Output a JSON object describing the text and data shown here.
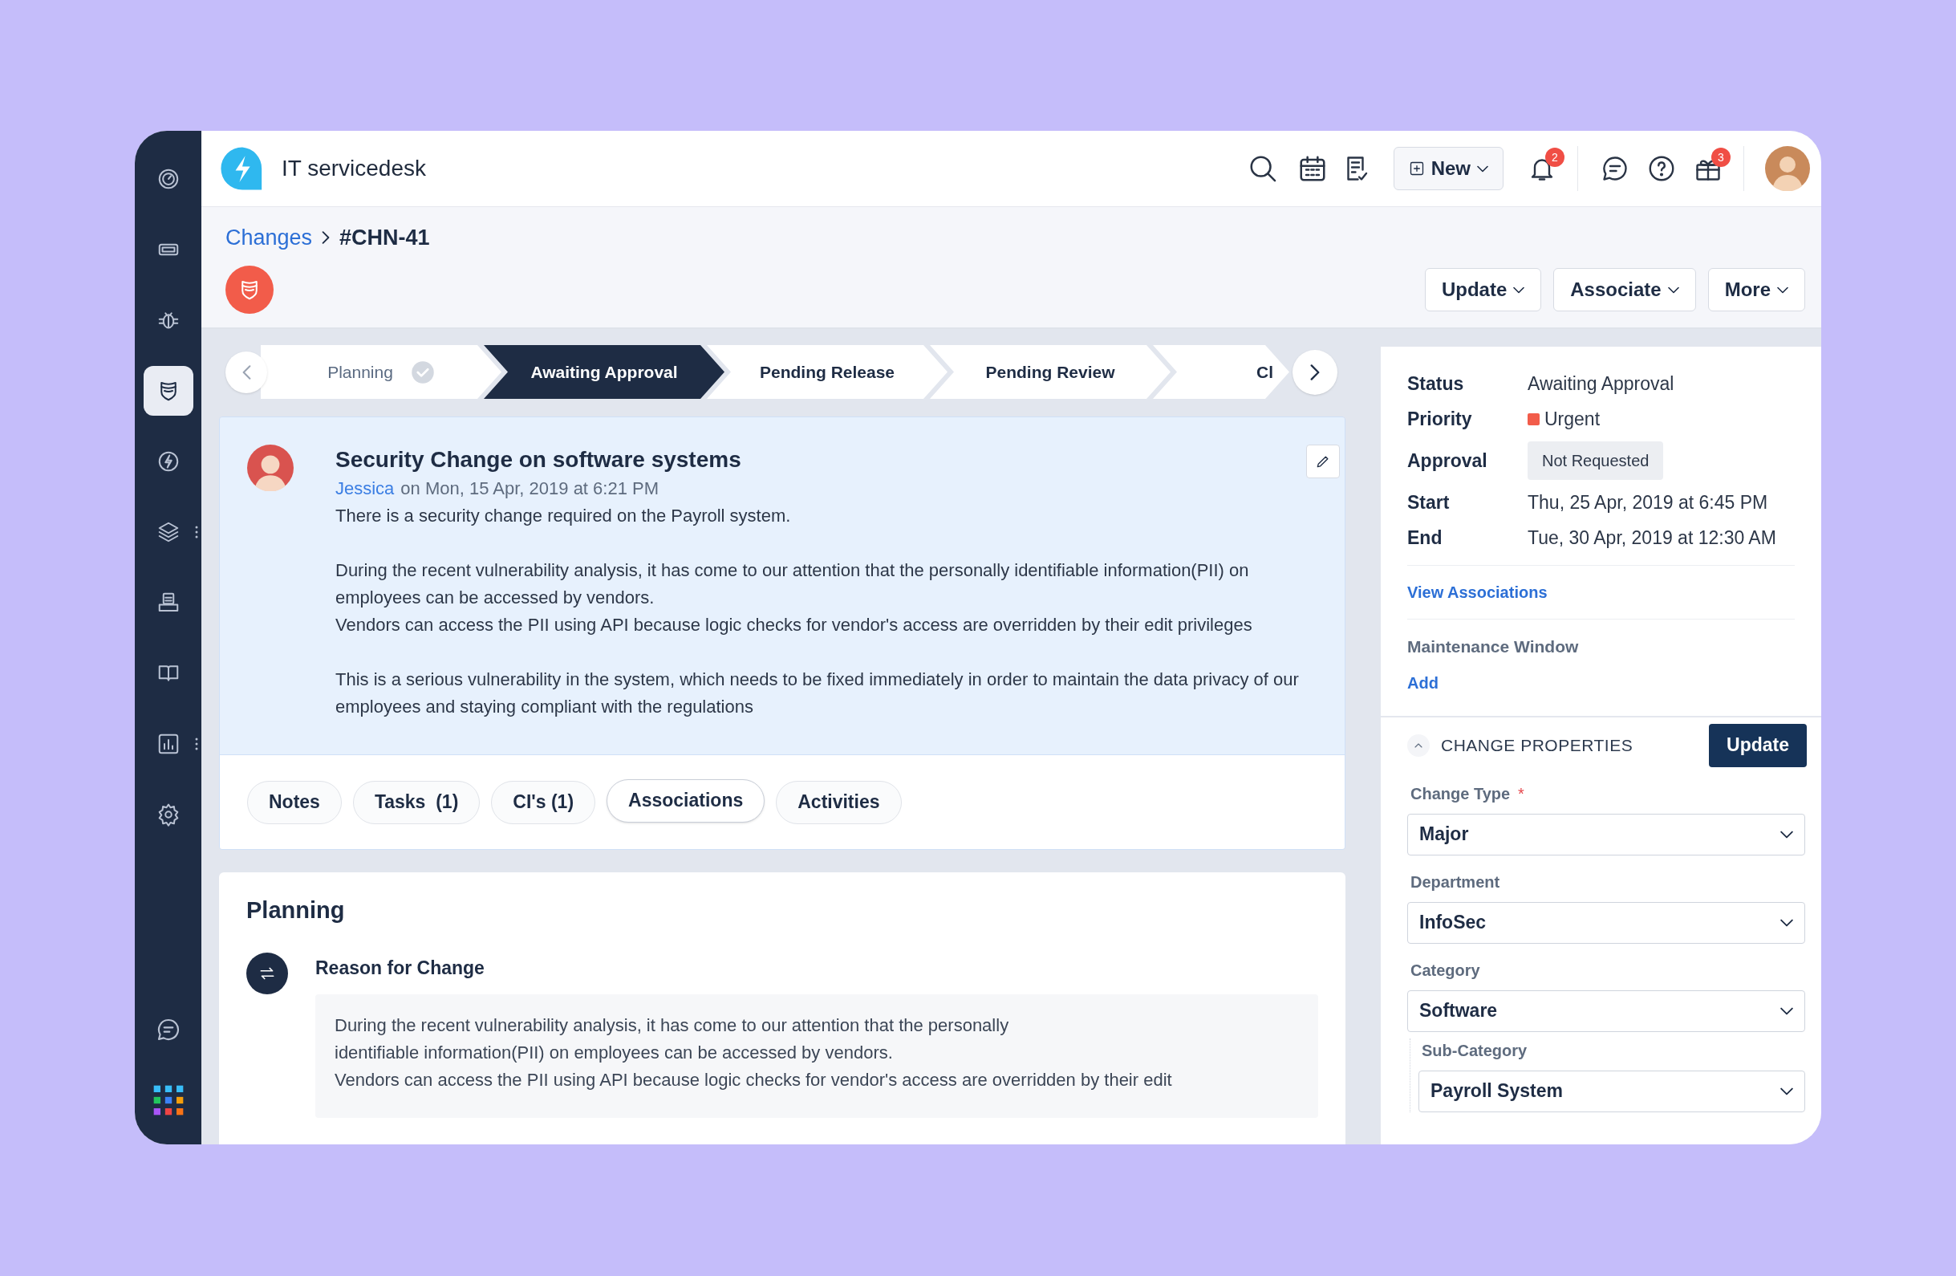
{
  "app": {
    "title": "IT servicedesk"
  },
  "sidebar": {
    "items": [
      {
        "selected": false,
        "menu": false
      },
      {
        "selected": false,
        "menu": false
      },
      {
        "selected": false,
        "menu": false
      },
      {
        "selected": true,
        "menu": false
      },
      {
        "selected": false,
        "menu": false
      },
      {
        "selected": false,
        "menu": true
      },
      {
        "selected": false,
        "menu": false
      },
      {
        "selected": false,
        "menu": false
      },
      {
        "selected": false,
        "menu": true
      },
      {
        "selected": false,
        "menu": false
      }
    ],
    "bottom_items": [
      {
        "selected": false
      },
      {
        "selected": false
      }
    ]
  },
  "top_bar": {
    "new_button": "New",
    "notification_count": "2",
    "gift_count": "3"
  },
  "breadcrumb": {
    "parent": "Changes",
    "current": "#CHN-41"
  },
  "actions": [
    "Update",
    "Associate",
    "More"
  ],
  "stepper": {
    "steps": [
      {
        "label": "Planning",
        "done": true,
        "selected": false
      },
      {
        "label": "Awaiting Approval",
        "done": false,
        "selected": true
      },
      {
        "label": "Pending Release",
        "done": false,
        "selected": false
      },
      {
        "label": "Pending Review",
        "done": false,
        "selected": false
      },
      {
        "label": "Cl",
        "done": false,
        "selected": false
      }
    ]
  },
  "request": {
    "title": "Security Change on software systems",
    "author": "Jessica",
    "meta": "on Mon, 15 Apr, 2019 at 6:21 PM",
    "paragraphs": [
      [
        "There is a security change required on the Payroll system."
      ],
      [
        "During the recent vulnerability analysis, it has come to our attention that the personally identifiable information(PII) on employees can be accessed by vendors.",
        "Vendors can access the PII using API because logic checks for vendor's access are overridden by their edit privileges"
      ],
      [
        "This is a serious vulnerability in the system, which needs to be fixed immediately in order to maintain the data privacy of our employees and staying compliant with the regulations"
      ]
    ]
  },
  "tabs": [
    {
      "label": "Notes",
      "selected": false
    },
    {
      "label": "Tasks  (1)",
      "selected": false
    },
    {
      "label": "CI's (1)",
      "selected": false
    },
    {
      "label": "Associations",
      "selected": true
    },
    {
      "label": "Activities",
      "selected": false
    }
  ],
  "planning": {
    "title": "Planning",
    "section_title": "Reason for Change",
    "lines": [
      "During the recent vulnerability analysis, it has come to our attention that the personally",
      "identifiable information(PII) on employees can be accessed by vendors.",
      "Vendors can access the PII using API because logic checks for vendor's access are overridden by their edit"
    ]
  },
  "details": {
    "fields": [
      {
        "label": "Status",
        "value": "Awaiting Approval",
        "kind": "text"
      },
      {
        "label": "Priority",
        "value": "Urgent",
        "kind": "priority",
        "color": "#f25c4a"
      },
      {
        "label": "Approval",
        "value": "Not Requested",
        "kind": "badge"
      },
      {
        "label": "Start",
        "value": "Thu, 25 Apr, 2019 at 6:45 PM",
        "kind": "text"
      },
      {
        "label": "End",
        "value": "Tue, 30 Apr, 2019 at 12:30 AM",
        "kind": "text"
      }
    ],
    "link": "View Associations",
    "maintenance_label": "Maintenance Window",
    "maintenance_action": "Add"
  },
  "properties": {
    "title": "CHANGE PROPERTIES",
    "expanded": true,
    "button": "Update",
    "fields": [
      {
        "label": "Change Type",
        "required_mark": "*",
        "value": "Major"
      },
      {
        "label": "Department",
        "value": "InfoSec"
      },
      {
        "label": "Category",
        "value": "Software",
        "children": [
          {
            "label": "Sub-Category",
            "value": "Payroll System"
          }
        ]
      }
    ]
  }
}
